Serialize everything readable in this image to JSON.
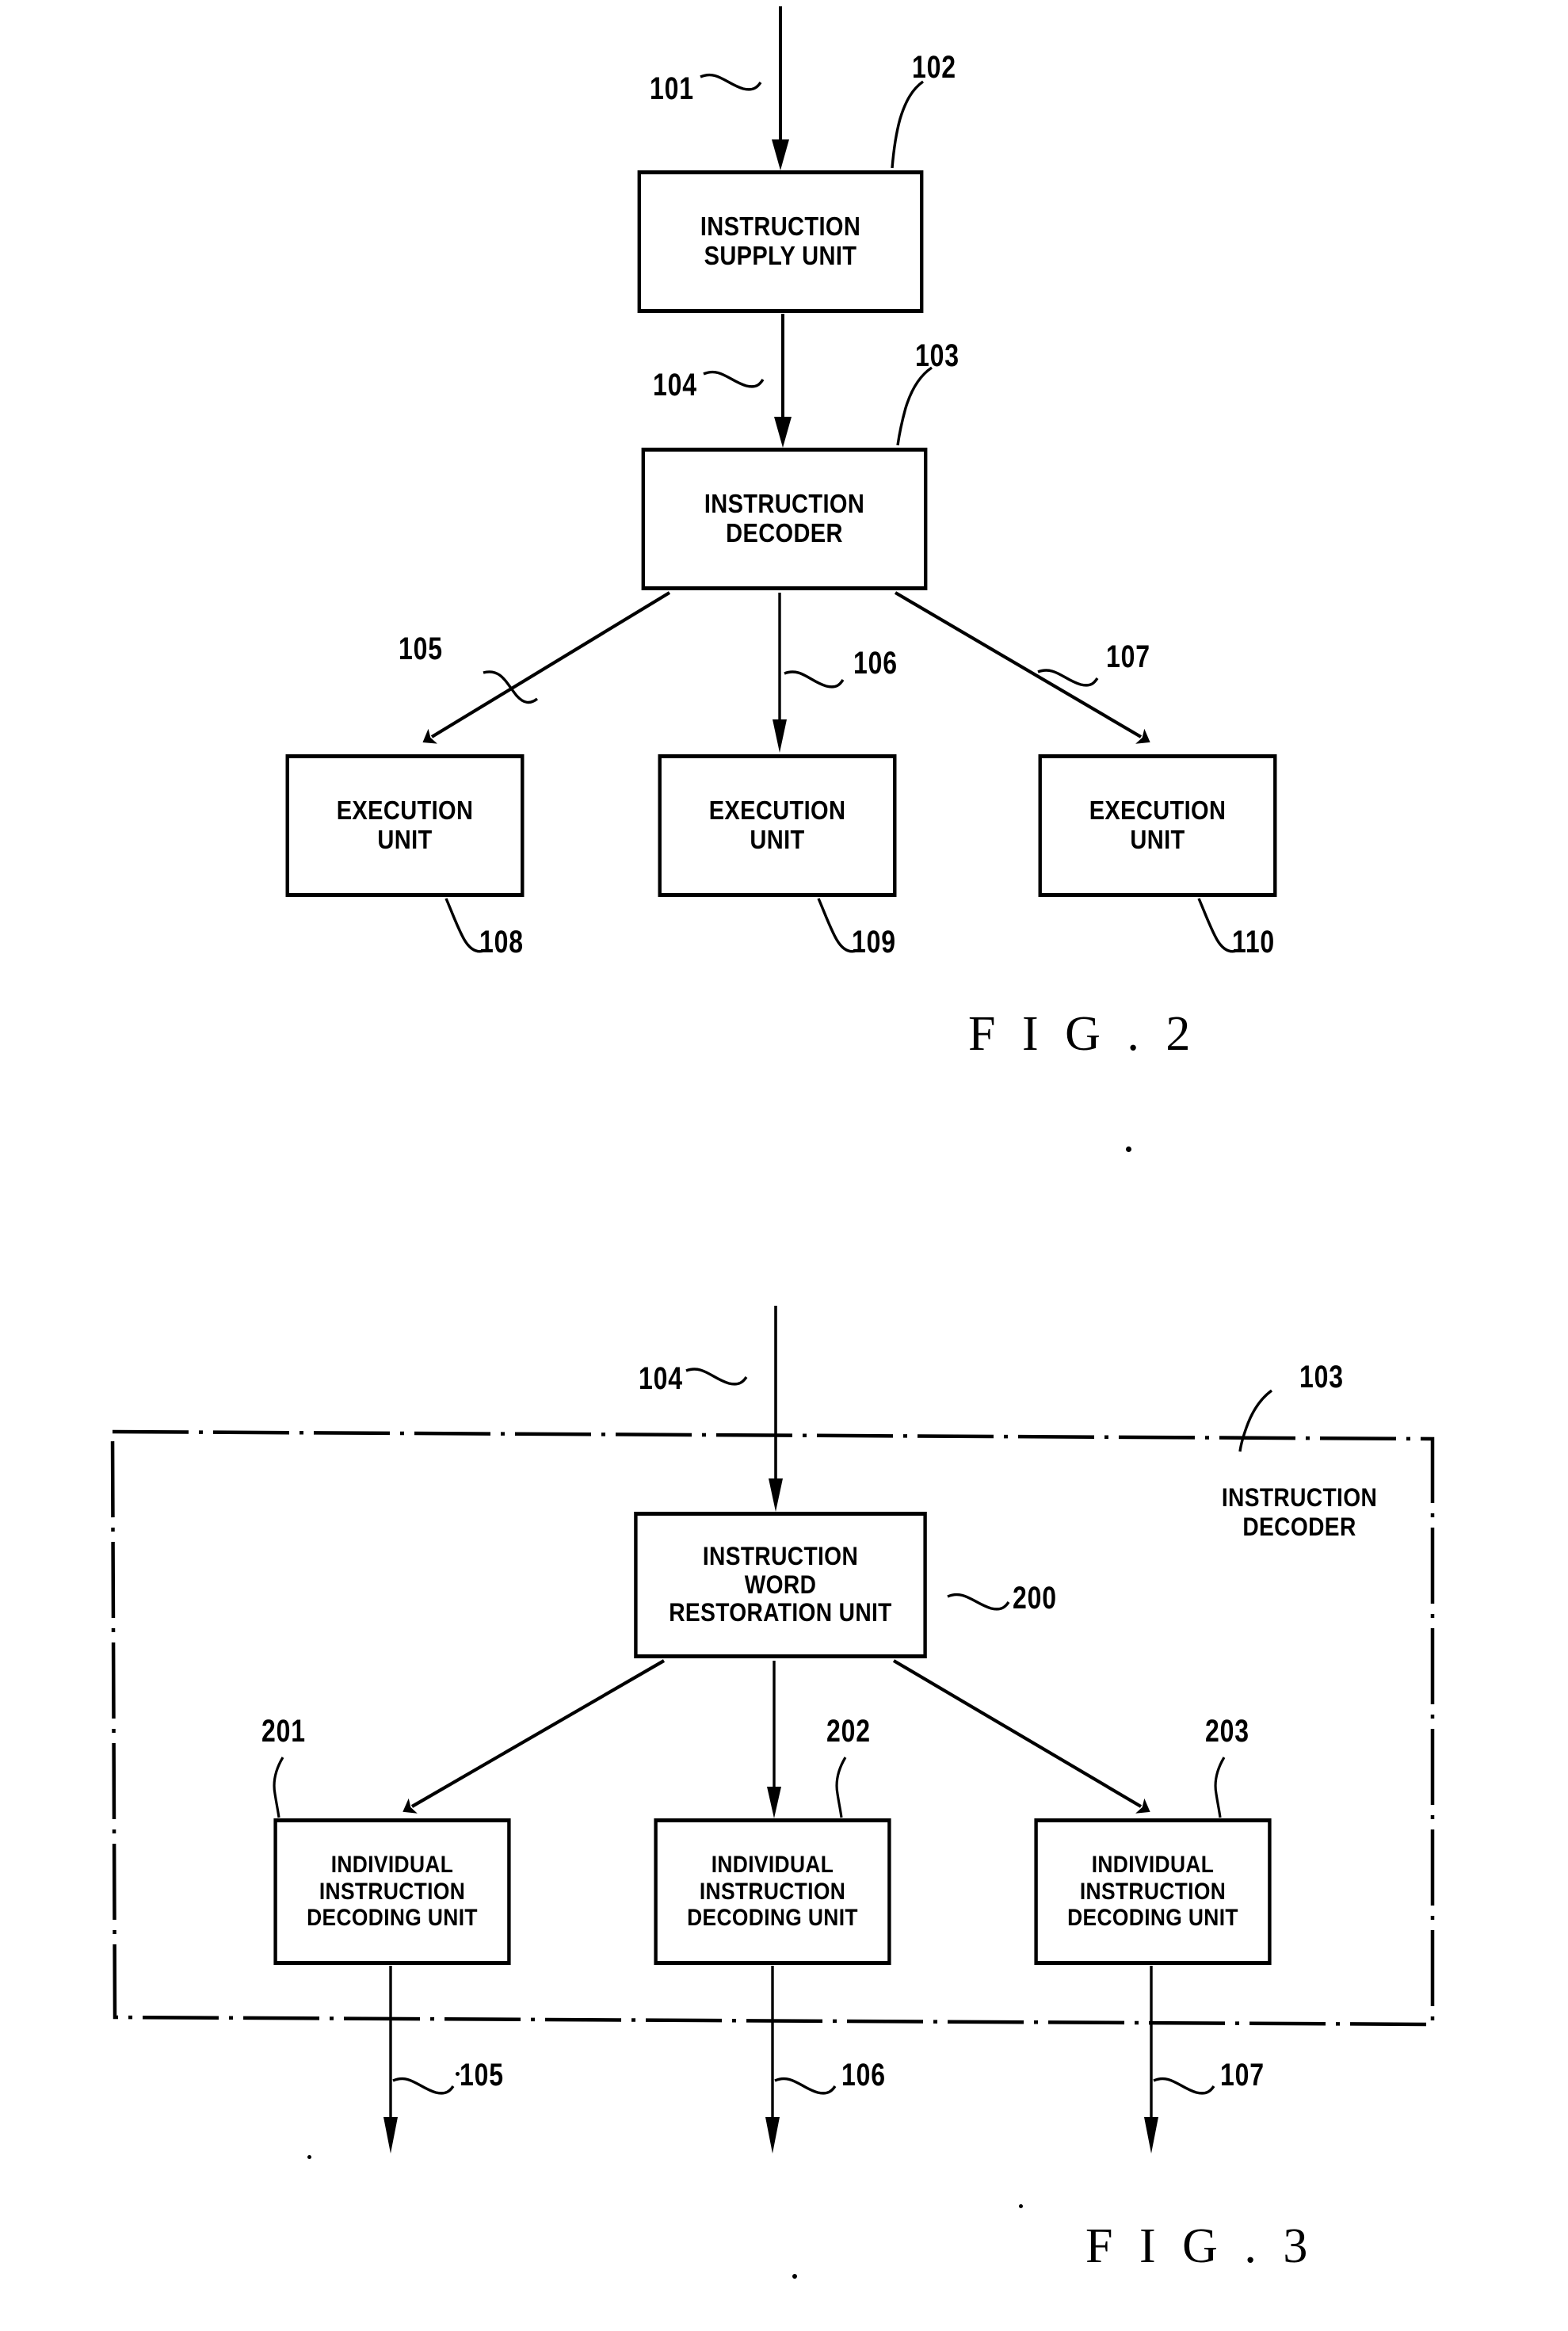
{
  "document": {
    "type": "patent-drawing-sheet",
    "figures": [
      "FIG. 2",
      "FIG. 3"
    ]
  },
  "fig2": {
    "caption": "F I G . 2",
    "blocks": [
      {
        "id": "102",
        "label": "INSTRUCTION\nSUPPLY UNIT"
      },
      {
        "id": "103",
        "label": "INSTRUCTION\nDECODER"
      },
      {
        "id": "108",
        "label": "EXECUTION\nUNIT"
      },
      {
        "id": "109",
        "label": "EXECUTION\nUNIT"
      },
      {
        "id": "110",
        "label": "EXECUTION\nUNIT"
      }
    ],
    "numerals": {
      "input_signal": "101",
      "supply_unit": "102",
      "decoder": "103",
      "decoder_input": "104",
      "out_left": "105",
      "out_middle": "106",
      "out_right": "107",
      "exec_left": "108",
      "exec_middle": "109",
      "exec_right": "110"
    }
  },
  "fig3": {
    "caption": "F I G . 3",
    "frame_label": "INSTRUCTION\nDECODER",
    "blocks": [
      {
        "id": "200",
        "label": "INSTRUCTION\nWORD\nRESTORATION UNIT"
      },
      {
        "id": "201",
        "label": "INDIVIDUAL\nINSTRUCTION\nDECODING UNIT"
      },
      {
        "id": "202",
        "label": "INDIVIDUAL\nINSTRUCTION\nDECODING UNIT"
      },
      {
        "id": "203",
        "label": "INDIVIDUAL\nINSTRUCTION\nDECODING UNIT"
      }
    ],
    "numerals": {
      "input_signal": "104",
      "decoder_frame": "103",
      "restoration_unit": "200",
      "idu_left": "201",
      "idu_middle": "202",
      "idu_right": "203",
      "out_left": "105",
      "out_middle": "106",
      "out_right": "107"
    }
  },
  "colors": {
    "ink": "#000000",
    "paper": "#ffffff"
  }
}
